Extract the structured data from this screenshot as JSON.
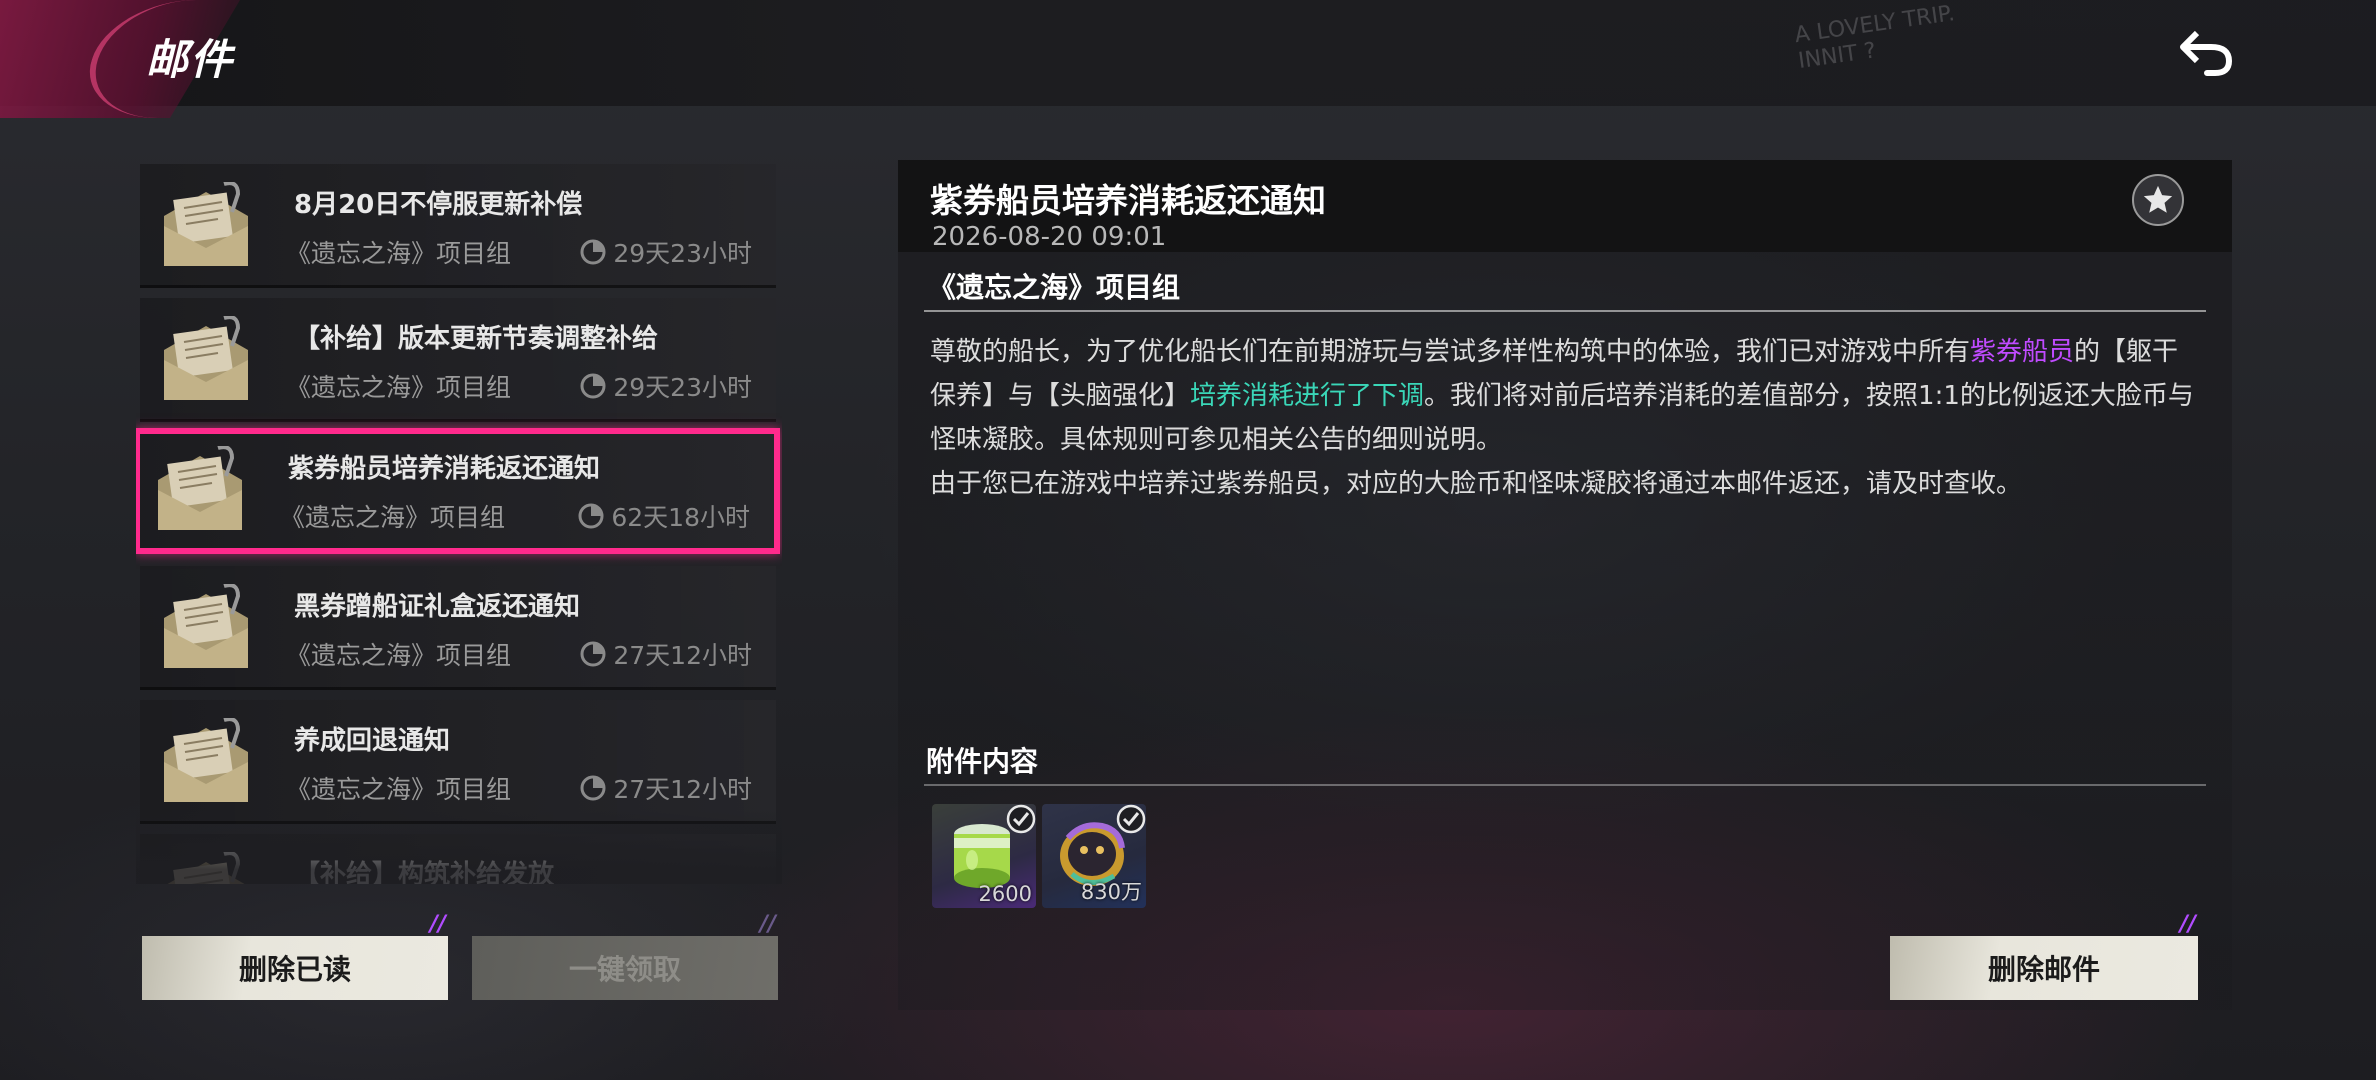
{
  "header": {
    "title": "邮件",
    "deco_text": "A LOVELY TRIP.\nINNIT ?"
  },
  "mail_list": [
    {
      "title": "8月20日不停服更新补偿",
      "sender": "《遗忘之海》项目组",
      "time_left": "29天23小时",
      "selected": false
    },
    {
      "title": "【补给】版本更新节奏调整补给",
      "sender": "《遗忘之海》项目组",
      "time_left": "29天23小时",
      "selected": false
    },
    {
      "title": "紫券船员培养消耗返还通知",
      "sender": "《遗忘之海》项目组",
      "time_left": "62天18小时",
      "selected": true
    },
    {
      "title": "黑券蹭船证礼盒返还通知",
      "sender": "《遗忘之海》项目组",
      "time_left": "27天12小时",
      "selected": false
    },
    {
      "title": "养成回退通知",
      "sender": "《遗忘之海》项目组",
      "time_left": "27天12小时",
      "selected": false
    },
    {
      "title": "【补给】构筑补给发放",
      "sender": "",
      "time_left": "",
      "selected": false
    }
  ],
  "buttons": {
    "delete_read": "删除已读",
    "claim_all": "一键领取",
    "delete_mail": "删除邮件"
  },
  "detail": {
    "title": "紫券船员培养消耗返还通知",
    "date": "2026-08-20 09:01",
    "sender": "《遗忘之海》项目组",
    "body": {
      "p1_a": "尊敬的船长，为了优化船长们在前期游玩与尝试多样性构筑中的体验，我们已对游戏中所有",
      "p1_hl1": "紫券船员",
      "p1_b": "的【躯干保养】与【头脑强化】",
      "p1_hl2": "培养消耗进行了下调",
      "p1_c": "。我们将对前后培养消耗的差值部分，按照1:1的比例返还大脸币与怪味凝胶。具体规则可参见相关公告的细则说明。",
      "p2": "由于您已在游戏中培养过紫券船员，对应的大脸币和怪味凝胶将通过本邮件返还，请及时查收。"
    },
    "attachments_title": "附件内容",
    "attachments": [
      {
        "name": "怪味凝胶",
        "count": "2600",
        "icon": "gel-jar-icon",
        "claimed": true
      },
      {
        "name": "大脸币",
        "count": "830万",
        "icon": "face-coin-icon",
        "claimed": true
      }
    ]
  },
  "colors": {
    "accent_pink": "#ff2a8c",
    "highlight_purple": "#c04bff",
    "highlight_cyan": "#3ad7b8"
  }
}
